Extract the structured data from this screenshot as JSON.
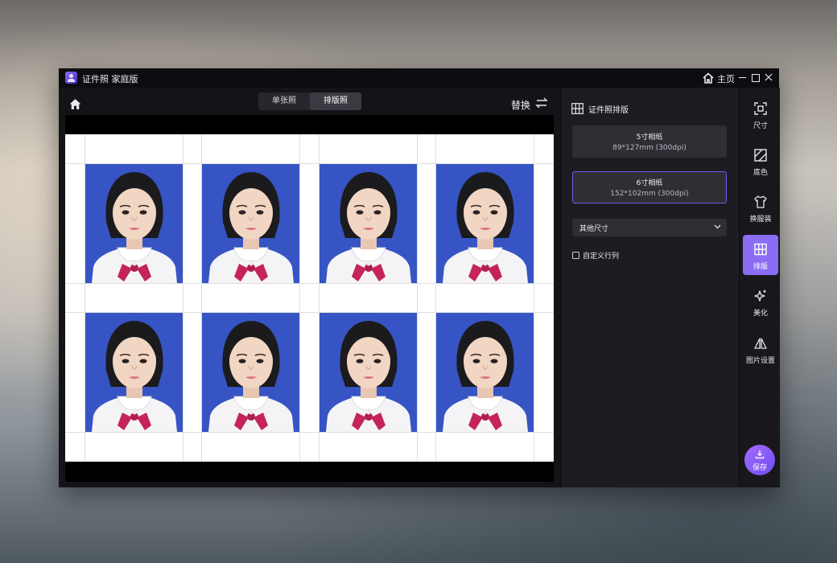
{
  "window": {
    "title": "证件照 家庭版",
    "home_label": "主页"
  },
  "toolbar": {
    "tabs": [
      "单张照",
      "排版照"
    ],
    "active_tab": "排版照",
    "replace_label": "替换"
  },
  "panel": {
    "title": "证件照排版",
    "options": [
      {
        "name": "5寸相纸",
        "size": "89*127mm (300dpi)",
        "selected": false
      },
      {
        "name": "6寸相纸",
        "size": "152*102mm (300dpi)",
        "selected": true
      }
    ],
    "dropdown_label": "其他尺寸",
    "checkbox_label": "自定义行列",
    "checkbox_checked": false
  },
  "rail": {
    "items": [
      {
        "label": "尺寸",
        "icon": "crop-frame-icon"
      },
      {
        "label": "底色",
        "icon": "background-color-icon"
      },
      {
        "label": "换服装",
        "icon": "shirt-icon"
      },
      {
        "label": "排版",
        "icon": "layout-grid-icon",
        "active": true
      },
      {
        "label": "美化",
        "icon": "sparkle-icon"
      },
      {
        "label": "图片设置",
        "icon": "mirror-icon"
      }
    ],
    "save_label": "保存"
  },
  "canvas": {
    "rows": 2,
    "columns": 4,
    "photo_background": "#3654c4"
  },
  "colors": {
    "accent": "#8b6cf5",
    "window_bg": "#131318"
  }
}
